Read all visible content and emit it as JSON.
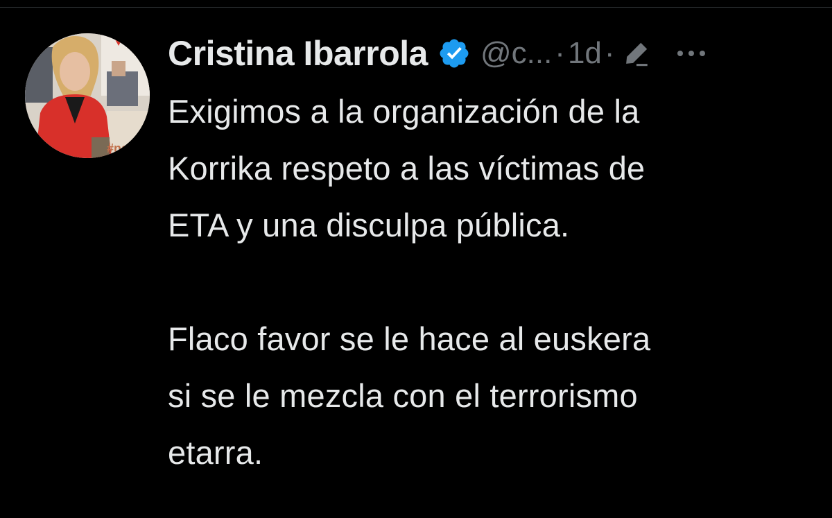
{
  "tweet": {
    "author": {
      "display_name": "Cristina Ibarrola",
      "handle": "@c...",
      "verified": true,
      "verified_icon": "verified-badge-icon",
      "avatar_badge_text": "UPN",
      "avatar_tag_text": "#nav"
    },
    "separator": "·",
    "time": "1d",
    "edited_icon": "edit-pencil-icon",
    "more_icon": "more-horizontal-icon",
    "text_paragraph_1": "Exigimos a la organización de la\nKorrika respeto a las víctimas de\nETA y una disculpa pública.",
    "text_paragraph_2": "Flaco favor se le hace al euskera\nsi se le mezcla con el terrorismo\netarra."
  },
  "colors": {
    "background": "#000000",
    "primary_text": "#e7e9ea",
    "secondary_text": "#71767b",
    "verified_blue": "#1d9bf0",
    "divider": "#2f3336"
  }
}
